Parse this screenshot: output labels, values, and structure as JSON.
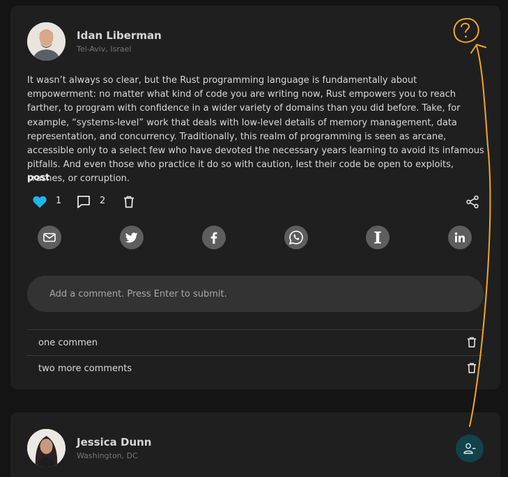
{
  "posts": [
    {
      "author": {
        "name": "Idan Liberman",
        "location": "Tel-Aviv, Israel"
      },
      "body": "It wasn’t always so clear, but the Rust programming language is fundamentally about empowerment: no matter what kind of code you are writing now, Rust empowers you to reach farther, to program with confidence in a wider variety of domains than you did before. Take, for example, “systems-level” work that deals with low-level details of memory management, data representation, and concurrency. Traditionally, this realm of programming is seen as arcane, accessible only to a select few who have devoted the necessary years learning to avoid its infamous pitfalls. And even those who practice it do so with caution, lest their code be open to exploits, crashes, or corruption.",
      "label": "post",
      "likes": "1",
      "comment_count": "2",
      "comment_placeholder": "Add a comment. Press Enter to submit.",
      "comments": [
        {
          "text": "one commen"
        },
        {
          "text": "two more comments"
        }
      ],
      "share_icons": [
        "email-icon",
        "twitter-icon",
        "facebook-icon",
        "whatsapp-icon",
        "instapaper-icon",
        "linkedin-icon"
      ]
    },
    {
      "author": {
        "name": "Jessica Dunn",
        "location": "Washington, DC"
      }
    }
  ],
  "colors": {
    "background": "#141414",
    "card": "#1f1f1f",
    "like_accent": "#1fb6e8",
    "annotation": "#f5a623",
    "unfollow_button": "#12424a"
  }
}
